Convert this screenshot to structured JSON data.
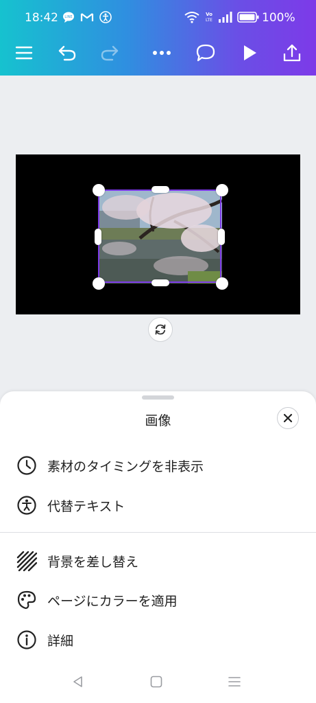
{
  "status_bar": {
    "time": "18:42",
    "battery": "100%",
    "left_icons": [
      "line-app-icon",
      "gmail-icon",
      "accessibility-icon"
    ],
    "right_icons": [
      "wifi-icon",
      "volte-icon",
      "signal-icon",
      "battery-icon"
    ]
  },
  "toolbar": {
    "icons": [
      "menu-icon",
      "undo-icon",
      "redo-icon",
      "more-icon",
      "comment-icon",
      "play-icon",
      "share-icon"
    ],
    "redo_enabled": false
  },
  "canvas": {
    "background": "#000000",
    "selection_color": "#7d3ae8"
  },
  "sheet": {
    "title": "画像",
    "items": [
      {
        "label": "素材のタイミングを非表示",
        "icon": "clock-icon"
      },
      {
        "label": "代替テキスト",
        "icon": "accessibility-icon"
      }
    ],
    "items2": [
      {
        "label": "背景を差し替え",
        "icon": "hatch-icon"
      },
      {
        "label": "ページにカラーを適用",
        "icon": "palette-icon"
      },
      {
        "label": "詳細",
        "icon": "info-icon"
      }
    ]
  },
  "nav": {
    "icons": [
      "back-icon",
      "home-icon",
      "recents-icon"
    ]
  },
  "colors": {
    "header_gradient_start": "#16c2cf",
    "header_gradient_end": "#7d3ae8",
    "sheet_bg": "#ffffff",
    "page_bg": "#eceef1"
  }
}
